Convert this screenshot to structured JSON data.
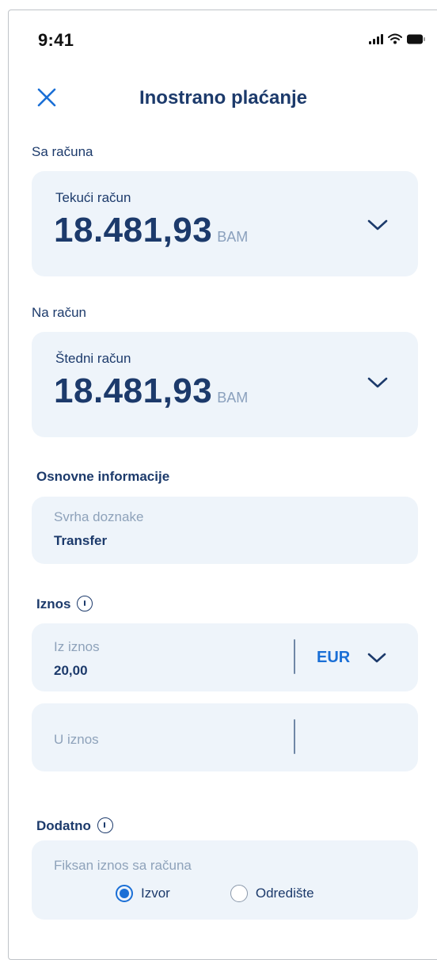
{
  "status_bar": {
    "time": "9:41"
  },
  "header": {
    "title": "Inostrano plaćanje"
  },
  "from_account": {
    "section_label": "Sa računa",
    "name": "Tekući račun",
    "amount": "18.481,93",
    "currency": "BAM"
  },
  "to_account": {
    "section_label": "Na račun",
    "name": "Štedni račun",
    "amount": "18.481,93",
    "currency": "BAM"
  },
  "basic_info": {
    "section_label": "Osnovne informacije",
    "purpose_label": "Svrha doznake",
    "purpose_value": "Transfer"
  },
  "amount": {
    "section_label": "Iznos",
    "from_label": "Iz iznos",
    "from_value": "20,00",
    "from_currency": "EUR",
    "to_label": "U iznos"
  },
  "additional": {
    "section_label": "Dodatno",
    "fixed_label": "Fiksan iznos sa računa",
    "options": [
      "Izvor",
      "Odredište"
    ],
    "selected": "Izvor"
  },
  "colors": {
    "accent": "#1a6fd6",
    "text": "#1c3a6b",
    "card_bg": "#eef4fa",
    "muted": "#8ea2ba"
  }
}
